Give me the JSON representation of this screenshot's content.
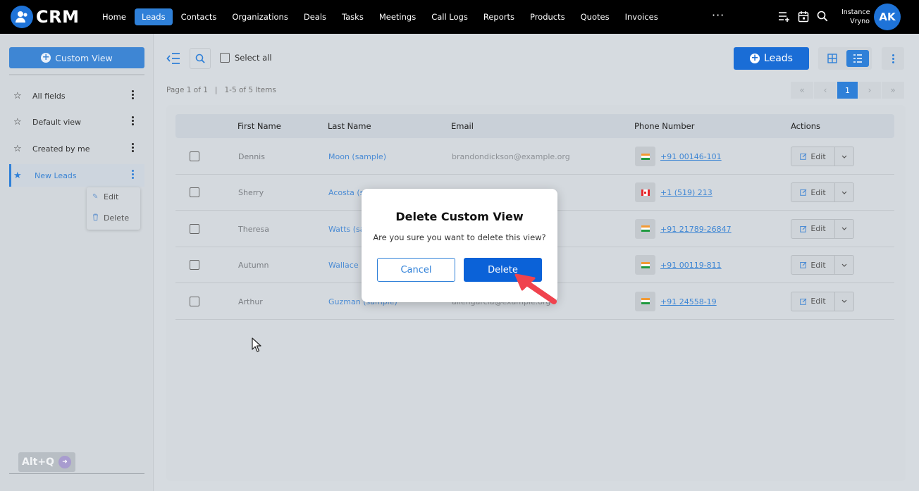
{
  "app": {
    "name": "CRM",
    "nav": [
      "Home",
      "Leads",
      "Contacts",
      "Organizations",
      "Deals",
      "Tasks",
      "Meetings",
      "Call Logs",
      "Reports",
      "Products",
      "Quotes",
      "Invoices"
    ],
    "active_nav": "Leads",
    "more": "···",
    "instance_line1": "Instance",
    "instance_line2": "Vryno",
    "avatar_initials": "AK"
  },
  "sidebar": {
    "custom_view_label": "Custom View",
    "views": [
      {
        "label": "All fields",
        "starred": false
      },
      {
        "label": "Default view",
        "starred": false
      },
      {
        "label": "Created by me",
        "starred": false
      },
      {
        "label": "New Leads",
        "starred": true,
        "active": true
      }
    ],
    "context_menu": {
      "edit": "Edit",
      "delete": "Delete"
    },
    "shortcut_badge": "Alt+Q"
  },
  "toolbar": {
    "select_all": "Select all",
    "new_button": "Leads",
    "page_info": "Page 1 of 1   |   1-5 of 5 Items",
    "current_page": "1"
  },
  "table": {
    "columns": [
      "First Name",
      "Last Name",
      "Email",
      "Phone Number",
      "Actions"
    ],
    "rows": [
      {
        "first": "Dennis",
        "last": "Moon (sample)",
        "email": "brandondickson@example.org",
        "flag": "IN",
        "phone": "+91 00146-101"
      },
      {
        "first": "Sherry",
        "last": "Acosta (s",
        "email": "",
        "flag": "CA",
        "phone": "+1 (519) 213"
      },
      {
        "first": "Theresa",
        "last": "Watts (sa",
        "email": "",
        "flag": "IN",
        "phone": "+91 21789-26847"
      },
      {
        "first": "Autumn",
        "last": "Wallace (",
        "email": "",
        "flag": "IN",
        "phone": "+91 00119-811"
      },
      {
        "first": "Arthur",
        "last": "Guzman (sample)",
        "email": "allengarcia@example.org",
        "flag": "IN",
        "phone": "+91 24558-19"
      }
    ],
    "edit_label": "Edit"
  },
  "modal": {
    "title": "Delete Custom View",
    "message": "Are you sure you want to delete this view?",
    "cancel": "Cancel",
    "confirm": "Delete"
  },
  "colors": {
    "topbar": "#000000",
    "accent": "#2f80d8",
    "primary_button": "#0b62d8",
    "annotation_arrow": "#f0434e"
  }
}
